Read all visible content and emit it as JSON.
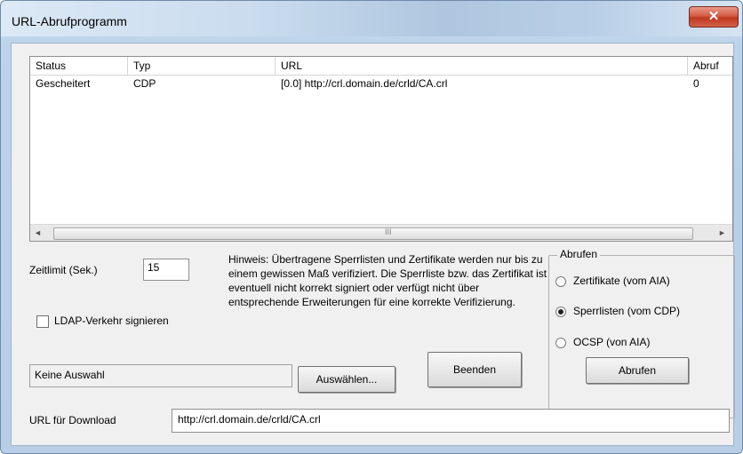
{
  "window": {
    "title": "URL-Abrufprogramm",
    "close_glyph": "✕"
  },
  "list": {
    "columns": [
      "Status",
      "Typ",
      "URL",
      "Abruf"
    ],
    "rows": [
      {
        "status": "Gescheitert",
        "typ": "CDP",
        "url": "[0.0] http://crl.domain.de/crld/CA.crl",
        "abruf": "0"
      }
    ],
    "scroll_left": "◄",
    "scroll_right": "►",
    "scroll_grip": "III"
  },
  "timeout": {
    "label": "Zeitlimit (Sek.)",
    "value": "15"
  },
  "ldap": {
    "label": "LDAP-Verkehr signieren",
    "checked": false
  },
  "hint": "Hinweis: Übertragene Sperrlisten und Zertifikate werden nur bis zu einem gewissen Maß verifiziert. Die Sperrliste bzw. das Zertifikat ist eventuell nicht korrekt signiert oder verfügt nicht über entsprechende Erweiterungen für eine korrekte Verifizierung.",
  "selection": {
    "value": "Keine Auswahl",
    "select_button": "Auswählen...",
    "exit_button": "Beenden"
  },
  "retrieve": {
    "legend": "Abrufen",
    "options": [
      "Zertifikate (vom AIA)",
      "Sperrlisten (vom CDP)",
      "OCSP (von AIA)"
    ],
    "selected_index": 1,
    "button": "Abrufen"
  },
  "download": {
    "label": "URL für Download",
    "value": "http://crl.domain.de/crld/CA.crl"
  }
}
